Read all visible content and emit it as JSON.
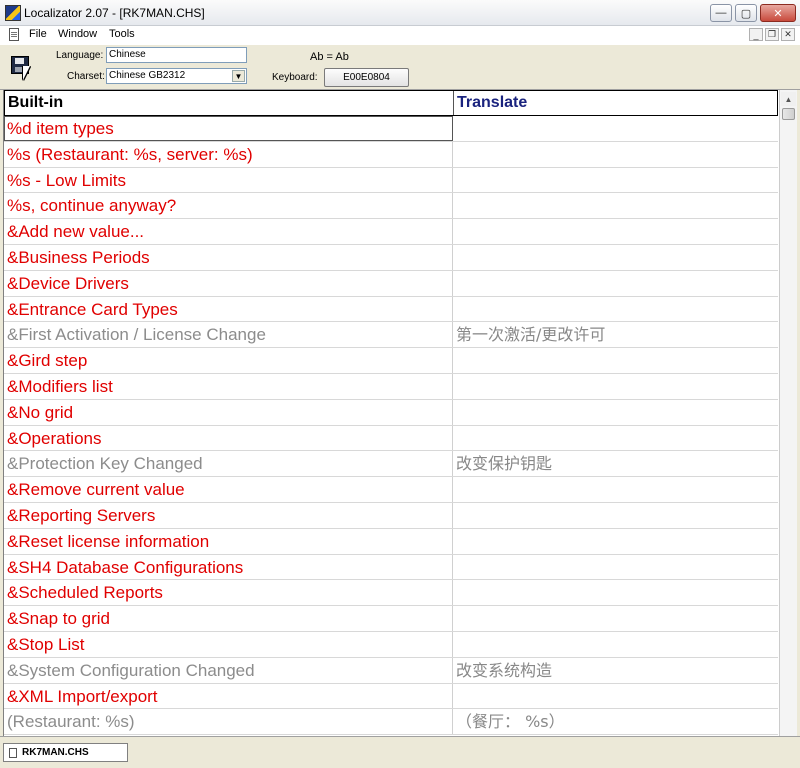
{
  "window": {
    "title": "Localizator 2.07 - [RK7MAN.CHS]",
    "minimize_symbol": "—",
    "maximize_symbol": "▢",
    "close_symbol": "✕"
  },
  "menu": {
    "items": [
      "File",
      "Window",
      "Tools"
    ],
    "mdi_min": "_",
    "mdi_restore": "❐",
    "mdi_close": "✕"
  },
  "toolbar": {
    "language_label": "Language:",
    "language_value": "Chinese",
    "charset_label": "Charset:",
    "charset_value": "Chinese GB2312",
    "preview_text": "Ab = Ab",
    "keyboard_label": "Keyboard:",
    "keyboard_value": "E00E0804"
  },
  "grid": {
    "headers": {
      "builtin": "Built-in",
      "translate": "Translate"
    },
    "rows": [
      {
        "builtin": "%d item types",
        "translate": "",
        "status": "untranslated"
      },
      {
        "builtin": "%s (Restaurant: %s, server: %s)",
        "translate": "",
        "status": "untranslated"
      },
      {
        "builtin": "%s - Low Limits",
        "translate": "",
        "status": "untranslated"
      },
      {
        "builtin": "%s, continue anyway?",
        "translate": "",
        "status": "untranslated"
      },
      {
        "builtin": "&Add new value...",
        "translate": "",
        "status": "untranslated"
      },
      {
        "builtin": "&Business Periods",
        "translate": "",
        "status": "untranslated"
      },
      {
        "builtin": "&Device Drivers",
        "translate": "",
        "status": "untranslated"
      },
      {
        "builtin": "&Entrance Card Types",
        "translate": "",
        "status": "untranslated"
      },
      {
        "builtin": "&First Activation / License Change",
        "translate": "第一次激活/更改许可",
        "status": "translated"
      },
      {
        "builtin": "&Gird step",
        "translate": "",
        "status": "untranslated"
      },
      {
        "builtin": "&Modifiers list",
        "translate": "",
        "status": "untranslated"
      },
      {
        "builtin": "&No grid",
        "translate": "",
        "status": "untranslated"
      },
      {
        "builtin": "&Operations",
        "translate": "",
        "status": "untranslated"
      },
      {
        "builtin": "&Protection Key Changed",
        "translate": "改变保护钥匙",
        "status": "translated"
      },
      {
        "builtin": "&Remove current value",
        "translate": "",
        "status": "untranslated"
      },
      {
        "builtin": "&Reporting Servers",
        "translate": "",
        "status": "untranslated"
      },
      {
        "builtin": "&Reset license information",
        "translate": "",
        "status": "untranslated"
      },
      {
        "builtin": "&SH4 Database Configurations",
        "translate": "",
        "status": "untranslated"
      },
      {
        "builtin": "&Scheduled Reports",
        "translate": "",
        "status": "untranslated"
      },
      {
        "builtin": "&Snap to grid",
        "translate": "",
        "status": "untranslated"
      },
      {
        "builtin": "&Stop List",
        "translate": "",
        "status": "untranslated"
      },
      {
        "builtin": "&System Configuration Changed",
        "translate": "改变系统构造",
        "status": "translated"
      },
      {
        "builtin": "&XML Import/export",
        "translate": "",
        "status": "untranslated"
      },
      {
        "builtin": "(Restaurant: %s)",
        "translate": "（餐厅： %s）",
        "status": "translated"
      }
    ]
  },
  "colors": {
    "untranslated": "#e00000",
    "translated": "#8c8c8c",
    "translate_header": "#1a237e"
  },
  "bottom": {
    "doc_tab_label": "RK7MAN.CHS"
  }
}
